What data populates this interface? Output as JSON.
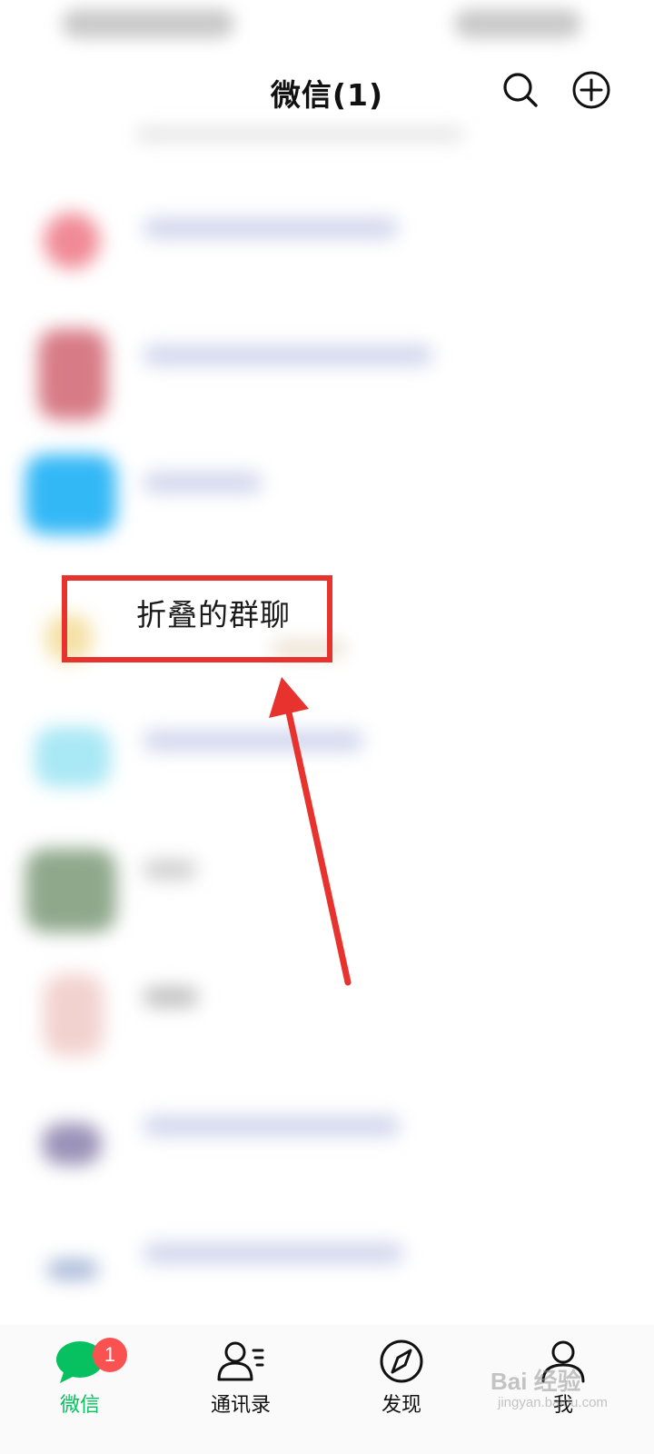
{
  "header": {
    "title": "微信(1)",
    "search_icon": "search-icon",
    "add_icon": "plus-circle-icon"
  },
  "annotation": {
    "label": "折叠的群聊",
    "color": "#e8322e"
  },
  "tabbar": {
    "tabs": [
      {
        "label": "微信",
        "icon": "chat-bubble-icon",
        "badge": "1",
        "active": true
      },
      {
        "label": "通讯录",
        "icon": "contacts-icon"
      },
      {
        "label": "发现",
        "icon": "compass-icon"
      },
      {
        "label": "我",
        "icon": "person-icon"
      }
    ],
    "active_color": "#07c160",
    "badge_color": "#fa5151"
  },
  "watermark": {
    "text": "Bai 经验",
    "sub": "jingyan.baidu.com"
  }
}
